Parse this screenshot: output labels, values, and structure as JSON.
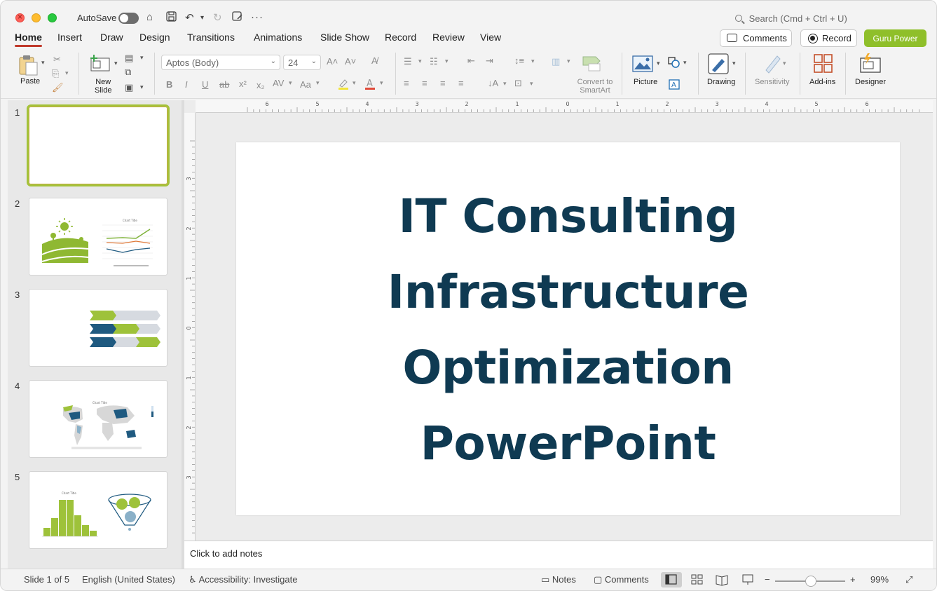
{
  "titlebar": {
    "autosave_label": "AutoSave",
    "search_placeholder": "Search (Cmd + Ctrl + U)"
  },
  "tabs": [
    "Home",
    "Insert",
    "Draw",
    "Design",
    "Transitions",
    "Animations",
    "Slide Show",
    "Record",
    "Review",
    "View"
  ],
  "active_tab": "Home",
  "actions": {
    "comments": "Comments",
    "record": "Record",
    "guru": "Guru Power"
  },
  "ribbon": {
    "paste": "Paste",
    "new_slide_line1": "New",
    "new_slide_line2": "Slide",
    "font_name": "Aptos (Body)",
    "font_size": "24",
    "convert_line1": "Convert to",
    "convert_line2": "SmartArt",
    "picture": "Picture",
    "drawing": "Drawing",
    "sensitivity": "Sensitivity",
    "addins": "Add-ins",
    "designer": "Designer"
  },
  "thumbnails": [
    {
      "num": "1"
    },
    {
      "num": "2",
      "chart_title": "Chart Title"
    },
    {
      "num": "3"
    },
    {
      "num": "4",
      "chart_title": "Chart Title"
    },
    {
      "num": "5",
      "chart_title": "Chart Title"
    }
  ],
  "ruler": {
    "top": [
      "6",
      "5",
      "4",
      "3",
      "2",
      "1",
      "0",
      "1",
      "2",
      "3",
      "4",
      "5",
      "6"
    ],
    "left": [
      "3",
      "2",
      "1",
      "0",
      "1",
      "2",
      "3"
    ]
  },
  "slide": {
    "title_lines": [
      "IT Consulting",
      "Infrastructure",
      "Optimization",
      "PowerPoint"
    ]
  },
  "notes_placeholder": "Click to add notes",
  "status": {
    "slide_info": "Slide 1 of 5",
    "language": "English (United States)",
    "accessibility": "Accessibility: Investigate",
    "notes": "Notes",
    "comments": "Comments",
    "zoom": "99%"
  },
  "colors": {
    "title_navy": "#0f3a52",
    "accent_green": "#8fbf2a",
    "tab_underline": "#c0392b"
  }
}
